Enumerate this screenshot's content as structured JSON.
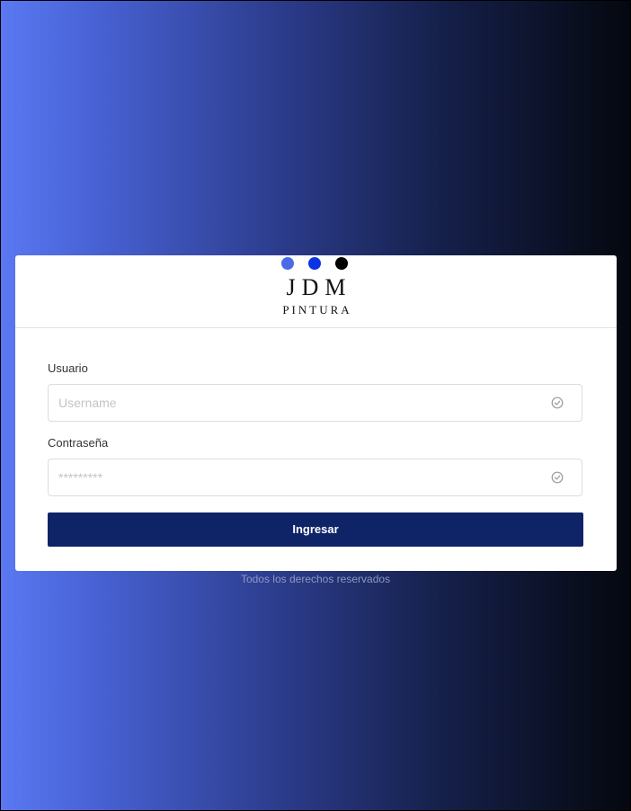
{
  "brand": {
    "title": "JDM",
    "subtitle": "PINTURA",
    "dots": [
      "#4b6ae6",
      "#0c33e3",
      "#000000"
    ]
  },
  "form": {
    "username": {
      "label": "Usuario",
      "placeholder": "Username",
      "value": ""
    },
    "password": {
      "label": "Contraseña",
      "placeholder": "*********",
      "value": ""
    },
    "validation_icon": "check-circle-icon",
    "submit_label": "Ingresar"
  },
  "footer": {
    "text": "Todos los derechos reservados"
  },
  "colors": {
    "button": "#0f2467",
    "gradient_start": "#5a78f2",
    "gradient_end": "#05080f"
  }
}
